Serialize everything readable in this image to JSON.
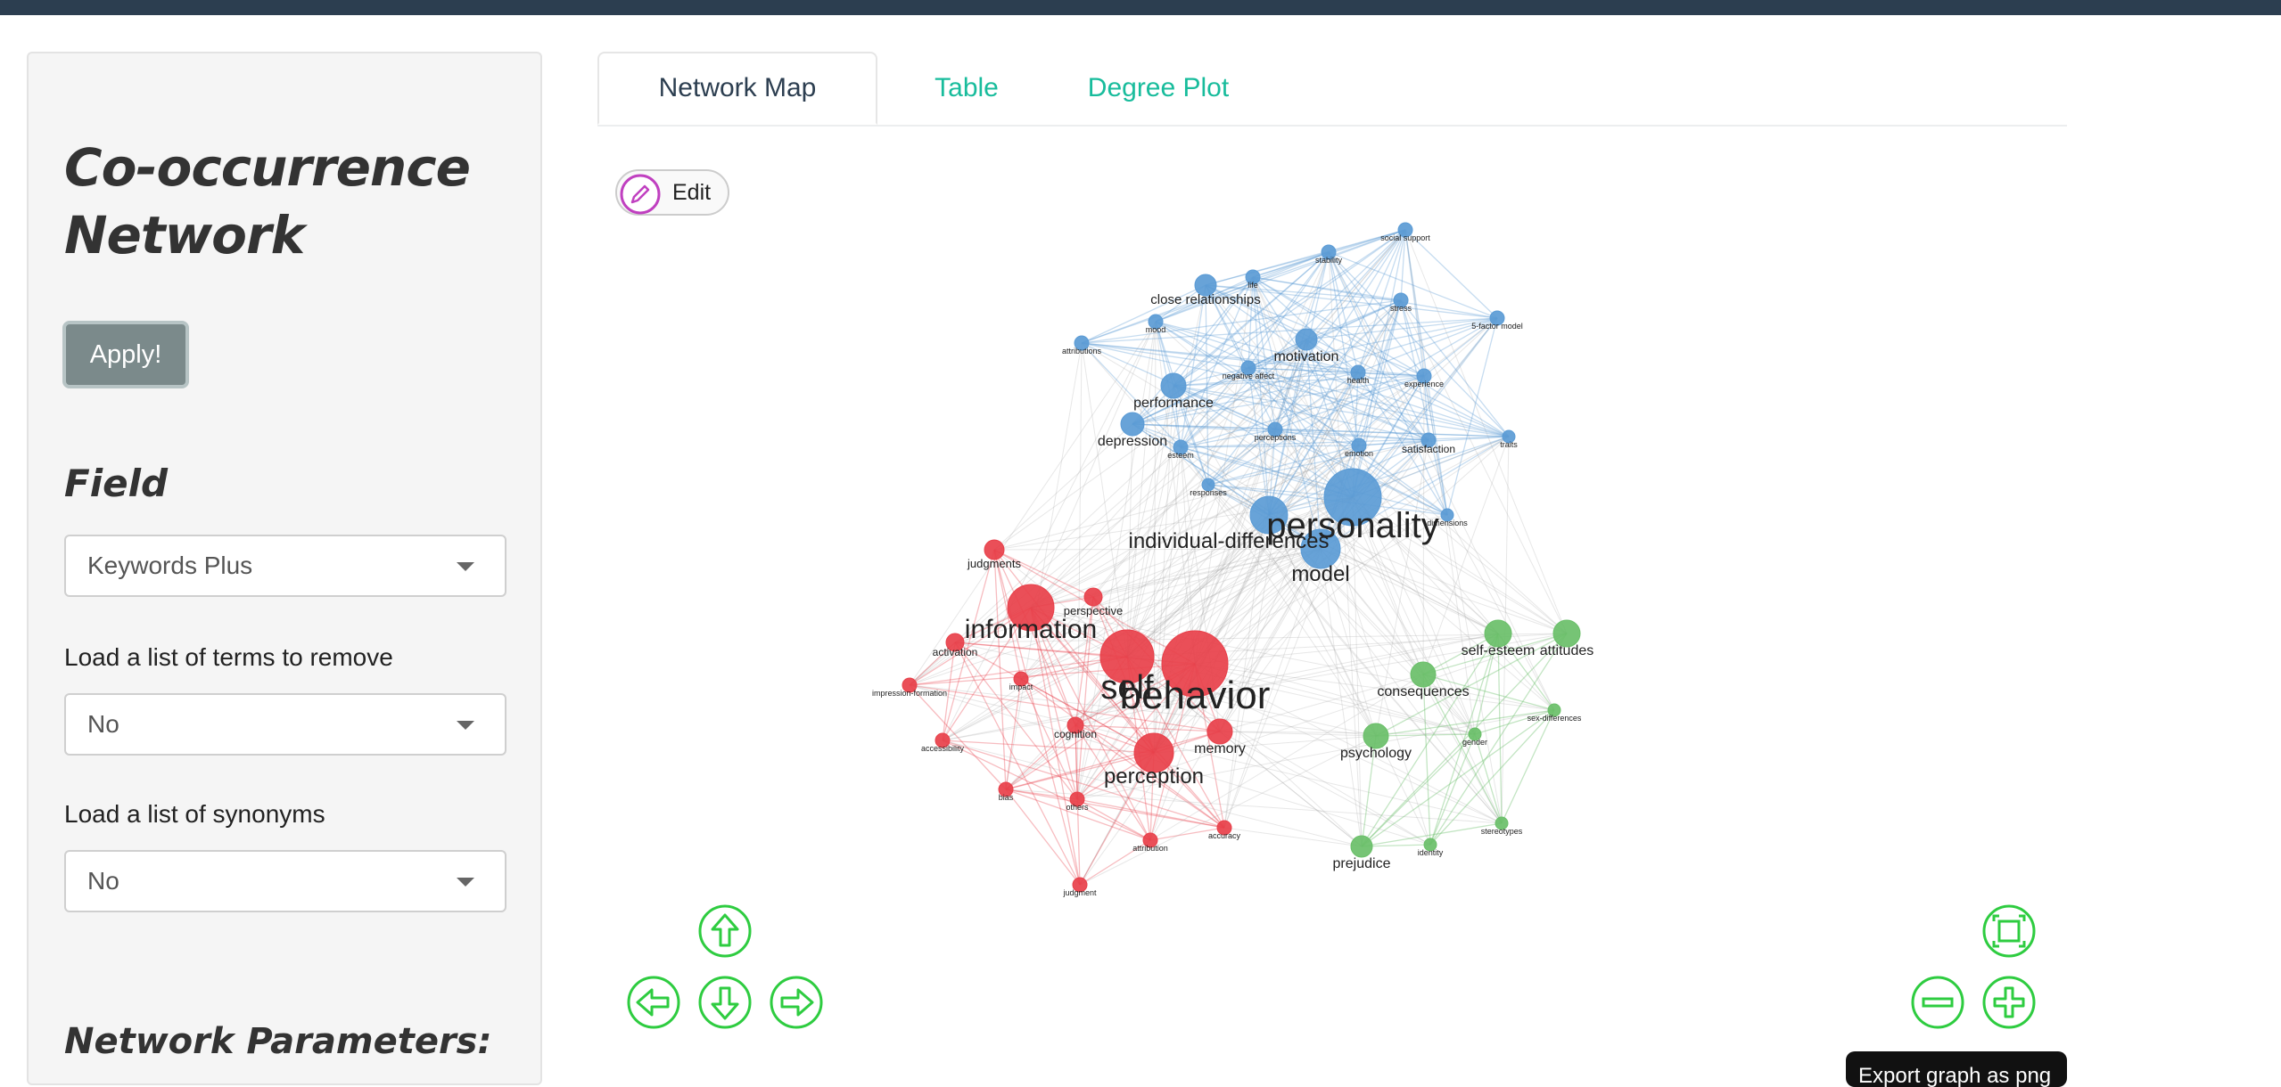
{
  "sidebar": {
    "title": "Co-occurrence Network",
    "apply_label": "Apply!",
    "field_heading": "Field",
    "field_value": "Keywords Plus",
    "remove_label": "Load a list of terms to remove",
    "remove_value": "No",
    "synonyms_label": "Load a list of synonyms",
    "synonyms_value": "No",
    "network_params_heading": "Network Parameters:"
  },
  "tabs": [
    {
      "label": "Network Map",
      "active": true
    },
    {
      "label": "Table",
      "active": false
    },
    {
      "label": "Degree Plot",
      "active": false
    }
  ],
  "edit_label": "Edit",
  "export_label": "Export graph as png",
  "colors": {
    "cluster1": "#5b9bd5",
    "cluster2": "#e8404a",
    "cluster3": "#6abf69",
    "accent": "#18bc9c",
    "nav": "#2ecc40"
  },
  "network": {
    "clusters": [
      {
        "name": "blue",
        "color": "#5b9bd5",
        "edge": "rgba(91,155,213,0.35)"
      },
      {
        "name": "red",
        "color": "#e8404a",
        "edge": "rgba(232,64,74,0.35)"
      },
      {
        "name": "green",
        "color": "#6abf69",
        "edge": "rgba(106,191,105,0.4)"
      }
    ],
    "nodes": [
      {
        "label": "personality",
        "cluster": 0
      },
      {
        "label": "individual-differences",
        "cluster": 0
      },
      {
        "label": "model",
        "cluster": 0
      },
      {
        "label": "close relationships",
        "cluster": 0
      },
      {
        "label": "performance",
        "cluster": 0
      },
      {
        "label": "depression",
        "cluster": 0
      },
      {
        "label": "motivation",
        "cluster": 0
      },
      {
        "label": "social support",
        "cluster": 0
      },
      {
        "label": "stability",
        "cluster": 0
      },
      {
        "label": "life",
        "cluster": 0
      },
      {
        "label": "stress",
        "cluster": 0
      },
      {
        "label": "5-factor model",
        "cluster": 0
      },
      {
        "label": "mood",
        "cluster": 0
      },
      {
        "label": "attributions",
        "cluster": 0
      },
      {
        "label": "negative affect",
        "cluster": 0
      },
      {
        "label": "health",
        "cluster": 0
      },
      {
        "label": "experience",
        "cluster": 0
      },
      {
        "label": "perceptions",
        "cluster": 0
      },
      {
        "label": "esteem",
        "cluster": 0
      },
      {
        "label": "emotion",
        "cluster": 0
      },
      {
        "label": "satisfaction",
        "cluster": 0
      },
      {
        "label": "traits",
        "cluster": 0
      },
      {
        "label": "responses",
        "cluster": 0
      },
      {
        "label": "dimensions",
        "cluster": 0
      },
      {
        "label": "behavior",
        "cluster": 1
      },
      {
        "label": "self",
        "cluster": 1
      },
      {
        "label": "information",
        "cluster": 1
      },
      {
        "label": "perception",
        "cluster": 1
      },
      {
        "label": "memory",
        "cluster": 1
      },
      {
        "label": "judgments",
        "cluster": 1
      },
      {
        "label": "perspective",
        "cluster": 1
      },
      {
        "label": "activation",
        "cluster": 1
      },
      {
        "label": "impression-formation",
        "cluster": 1
      },
      {
        "label": "impact",
        "cluster": 1
      },
      {
        "label": "cognition",
        "cluster": 1
      },
      {
        "label": "accessibility",
        "cluster": 1
      },
      {
        "label": "bias",
        "cluster": 1
      },
      {
        "label": "others",
        "cluster": 1
      },
      {
        "label": "attribution",
        "cluster": 1
      },
      {
        "label": "accuracy",
        "cluster": 1
      },
      {
        "label": "judgment",
        "cluster": 1
      },
      {
        "label": "self-esteem",
        "cluster": 2
      },
      {
        "label": "attitudes",
        "cluster": 2
      },
      {
        "label": "consequences",
        "cluster": 2
      },
      {
        "label": "psychology",
        "cluster": 2
      },
      {
        "label": "sex-differences",
        "cluster": 2
      },
      {
        "label": "gender",
        "cluster": 2
      },
      {
        "label": "stereotypes",
        "cluster": 2
      },
      {
        "label": "prejudice",
        "cluster": 2
      },
      {
        "label": "identity",
        "cluster": 2
      }
    ]
  }
}
